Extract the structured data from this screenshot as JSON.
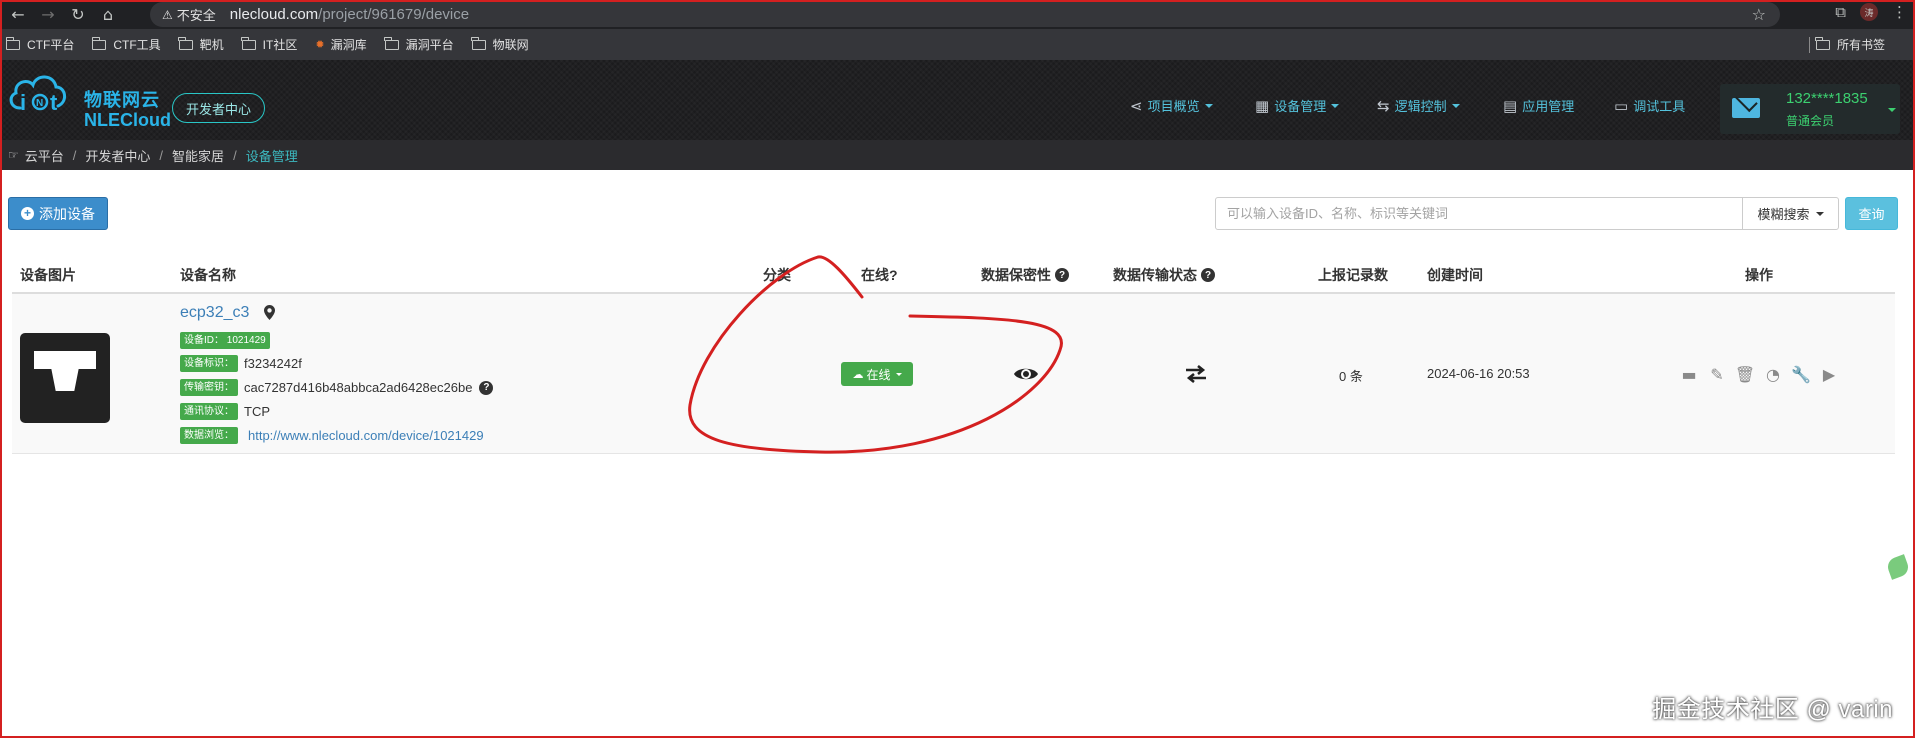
{
  "browser": {
    "insecure_label": "不安全",
    "url_host": "nlecloud.com",
    "url_path": "/project/961679/device",
    "profile_initial": "涛",
    "bookmarks": [
      "CTF平台",
      "CTF工具",
      "靶机",
      "IT社区",
      "漏洞库",
      "漏洞平台",
      "物联网"
    ],
    "all_bookmarks": "所有书签"
  },
  "site": {
    "logo_cn": "物联网云",
    "logo_en": "NLECloud",
    "dev_center": "开发者中心",
    "nav": [
      {
        "label": "项目概览",
        "icon": "share-icon",
        "has_caret": true
      },
      {
        "label": "设备管理",
        "icon": "grid-icon",
        "has_caret": true
      },
      {
        "label": "逻辑控制",
        "icon": "shuffle-icon",
        "has_caret": true
      },
      {
        "label": "应用管理",
        "icon": "archive-icon",
        "has_caret": false
      },
      {
        "label": "调试工具",
        "icon": "laptop-icon",
        "has_caret": false
      }
    ],
    "user": {
      "phone": "132****1835",
      "role": "普通会员"
    }
  },
  "breadcrumb": [
    "云平台",
    "开发者中心",
    "智能家居",
    "设备管理"
  ],
  "toolbar": {
    "add_label": "添加设备",
    "search_placeholder": "可以输入设备ID、名称、标识等关键词",
    "fuzzy_label": "模糊搜索",
    "query_label": "查询"
  },
  "table": {
    "headers": {
      "image": "设备图片",
      "name": "设备名称",
      "category": "分类",
      "online": "在线?",
      "privacy": "数据保密性",
      "transfer": "数据传输状态",
      "records": "上报记录数",
      "created": "创建时间",
      "actions": "操作"
    },
    "rows": [
      {
        "name": "ecp32_c3",
        "device_id_label": "设备ID：",
        "device_id": "1021429",
        "tag_label": "设备标识：",
        "tag_value": "f3234242f",
        "key_label": "传输密钥：",
        "key_value": "cac7287d416b48abbca2ad6428ec26be",
        "protocol_label": "通讯协议：",
        "protocol_value": "TCP",
        "browse_label": "数据浏览：",
        "browse_url": "http://www.nlecloud.com/device/1021429",
        "online_label": "在线",
        "records": "0 条",
        "created": "2024-06-16 20:53"
      }
    ]
  },
  "watermark": "掘金技术社区 @ varin",
  "colors": {
    "annotation": "#d42020",
    "online": "#45a94b",
    "link": "#3c7fb7",
    "accent": "#54c2dc"
  }
}
